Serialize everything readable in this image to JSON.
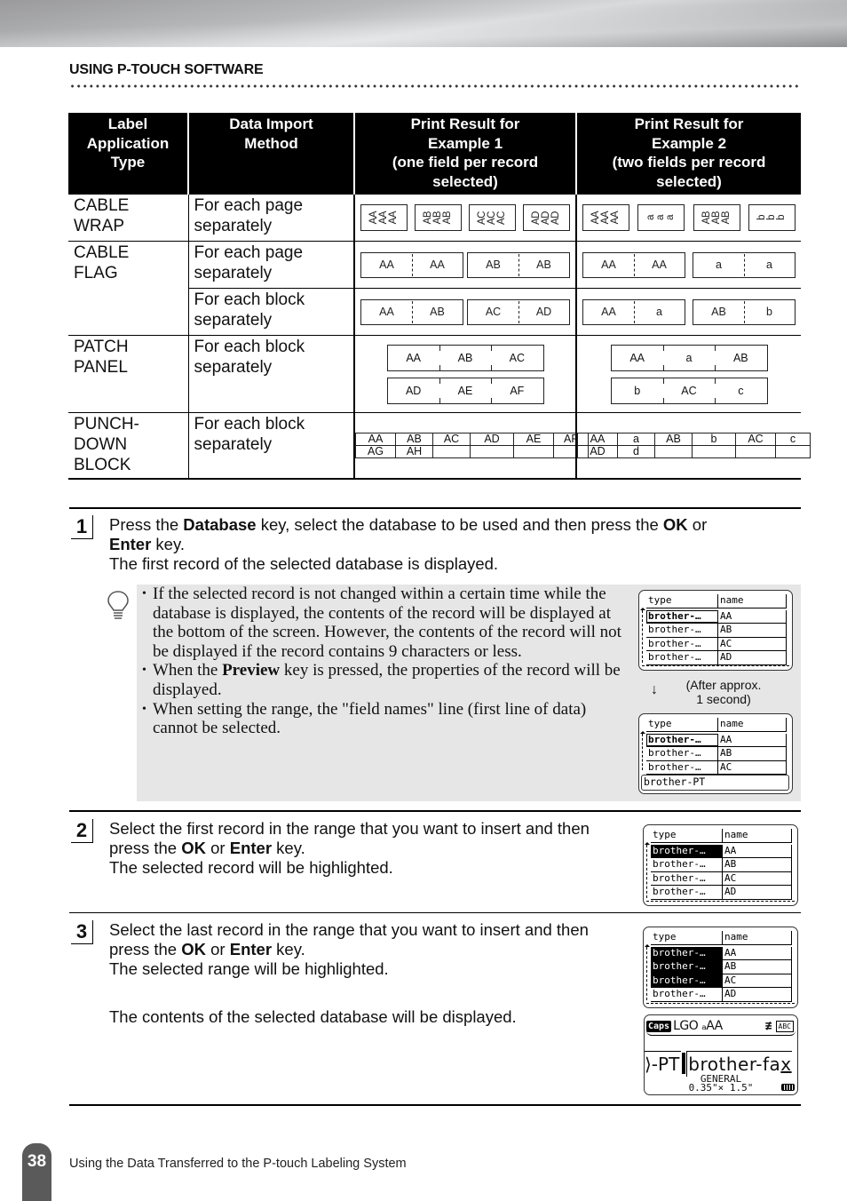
{
  "header": {
    "section_title": "USING P-TOUCH SOFTWARE"
  },
  "table": {
    "columns": [
      "Label Application Type",
      "Data Import Method",
      "Print Result for Example 1 (one field per record selected)",
      "Print Result for Example 2 (two fields per record selected)"
    ],
    "column_lines": [
      [
        "Label",
        "Application",
        "Type"
      ],
      [
        "Data Import",
        "Method"
      ],
      [
        "Print Result for",
        "Example 1",
        "(one field per record",
        "selected)"
      ],
      [
        "Print Result for",
        "Example 2",
        "(two fields per record",
        "selected)"
      ]
    ],
    "rows": [
      {
        "type": "CABLE WRAP",
        "type_lines": [
          "CABLE",
          "WRAP"
        ],
        "method_lines": [
          "For each page",
          "separately"
        ],
        "example1": [
          [
            "AA",
            "AA",
            "AA"
          ],
          [
            "AB",
            "AB",
            "AB"
          ],
          [
            "AC",
            "AC",
            "AC"
          ],
          [
            "AD",
            "AD",
            "AD"
          ]
        ],
        "example2": [
          [
            "AA",
            "AA",
            "AA"
          ],
          [
            "a",
            "a",
            "a"
          ],
          [
            "AB",
            "AB",
            "AB"
          ],
          [
            "b",
            "b",
            "b"
          ]
        ]
      },
      {
        "type": "CABLE FLAG",
        "type_lines": [
          "CABLE",
          "FLAG"
        ],
        "method_lines": [
          "For each page",
          "separately"
        ],
        "example1": [
          [
            "AA",
            "AA"
          ],
          [
            "AB",
            "AB"
          ]
        ],
        "example2": [
          [
            "AA",
            "AA"
          ],
          [
            "a",
            "a"
          ]
        ]
      },
      {
        "type": "CABLE FLAG",
        "method_lines": [
          "For each block",
          "separately"
        ],
        "example1": [
          [
            "AA",
            "AB"
          ],
          [
            "AC",
            "AD"
          ]
        ],
        "example2": [
          [
            "AA",
            "a"
          ],
          [
            "AB",
            "b"
          ]
        ]
      },
      {
        "type": "PATCH PANEL",
        "type_lines": [
          "PATCH",
          "PANEL"
        ],
        "method_lines": [
          "For each block",
          "separately"
        ],
        "example1": [
          [
            "AA",
            "AB",
            "AC"
          ],
          [
            "AD",
            "AE",
            "AF"
          ]
        ],
        "example2": [
          [
            "AA",
            "a",
            "AB"
          ],
          [
            "b",
            "AC",
            "c"
          ]
        ]
      },
      {
        "type": "PUNCH-DOWN BLOCK",
        "type_lines": [
          "PUNCH-",
          "DOWN",
          "BLOCK"
        ],
        "method_lines": [
          "For each block",
          "separately"
        ],
        "example1": [
          [
            "AA",
            "AB",
            "AC",
            "AD",
            "AE",
            "AF"
          ],
          [
            "AG",
            "AH",
            "",
            "",
            "",
            ""
          ]
        ],
        "example2": [
          [
            "AA",
            "a",
            "AB",
            "b",
            "AC",
            "c"
          ],
          [
            "AD",
            "d",
            "",
            "",
            "",
            ""
          ]
        ]
      }
    ]
  },
  "steps": [
    {
      "number": "1",
      "parts": [
        {
          "t": "Press the "
        },
        {
          "b": "Database"
        },
        {
          "t": " key, select the database to be used and then press the "
        },
        {
          "b": "OK"
        },
        {
          "t": " or "
        },
        {
          "br": true
        },
        {
          "b": "Enter"
        },
        {
          "t": " key."
        },
        {
          "br": true
        },
        {
          "t": "The first record of the selected database is displayed."
        }
      ]
    },
    {
      "number": "2",
      "parts": [
        {
          "t": "Select the first record in the range that you want to insert and then"
        },
        {
          "br": true
        },
        {
          "t": "press the "
        },
        {
          "b": "OK"
        },
        {
          "t": " or "
        },
        {
          "b": "Enter"
        },
        {
          "t": " key."
        },
        {
          "br": true
        },
        {
          "t": "The selected record will be highlighted."
        }
      ]
    },
    {
      "number": "3",
      "parts": [
        {
          "t": "Select the last record in the range that you want to insert and then"
        },
        {
          "br": true
        },
        {
          "t": "press the "
        },
        {
          "b": "OK"
        },
        {
          "t": " or "
        },
        {
          "b": "Enter"
        },
        {
          "t": " key."
        },
        {
          "br": true
        },
        {
          "t": "The selected range will be highlighted."
        }
      ],
      "extra": "The contents of the selected database will be displayed."
    }
  ],
  "note": {
    "icon": "lightbulb-icon",
    "items": [
      [
        {
          "t": "If the selected record is not changed within a certain time while the database is displayed, the contents of the record will be displayed at the bottom of the screen. However, the contents of the record will not be displayed if the record contains 9 characters or less."
        }
      ],
      [
        {
          "t": "When the "
        },
        {
          "b": "Preview"
        },
        {
          "t": " key is pressed, the properties of the record will be displayed."
        }
      ],
      [
        {
          "t": "When setting the range, the \"field names\" line (first line of data) cannot be selected."
        }
      ]
    ],
    "after_arrow": "↓",
    "after_text_lines": [
      "(After approx.",
      "1 second)"
    ]
  },
  "lcd": {
    "header": [
      "type",
      "name"
    ],
    "rows": [
      [
        "brother-…",
        "AA"
      ],
      [
        "brother-…",
        "AB"
      ],
      [
        "brother-…",
        "AC"
      ],
      [
        "brother-…",
        "AD"
      ]
    ],
    "footer_record": "brother-PT",
    "edit": {
      "caps": "Caps",
      "modes": "LGO ₐAA",
      "align_icon": "≢",
      "abc": "ABC",
      "prev_text": "⟩-PT",
      "current_text_main": "brother-fa",
      "current_text_cursor": "x",
      "style": "GENERAL",
      "size": "0.35\"× 1.5\""
    }
  },
  "footer": {
    "page_number": "38",
    "text": "Using the Data Transferred to the P-touch Labeling System"
  }
}
